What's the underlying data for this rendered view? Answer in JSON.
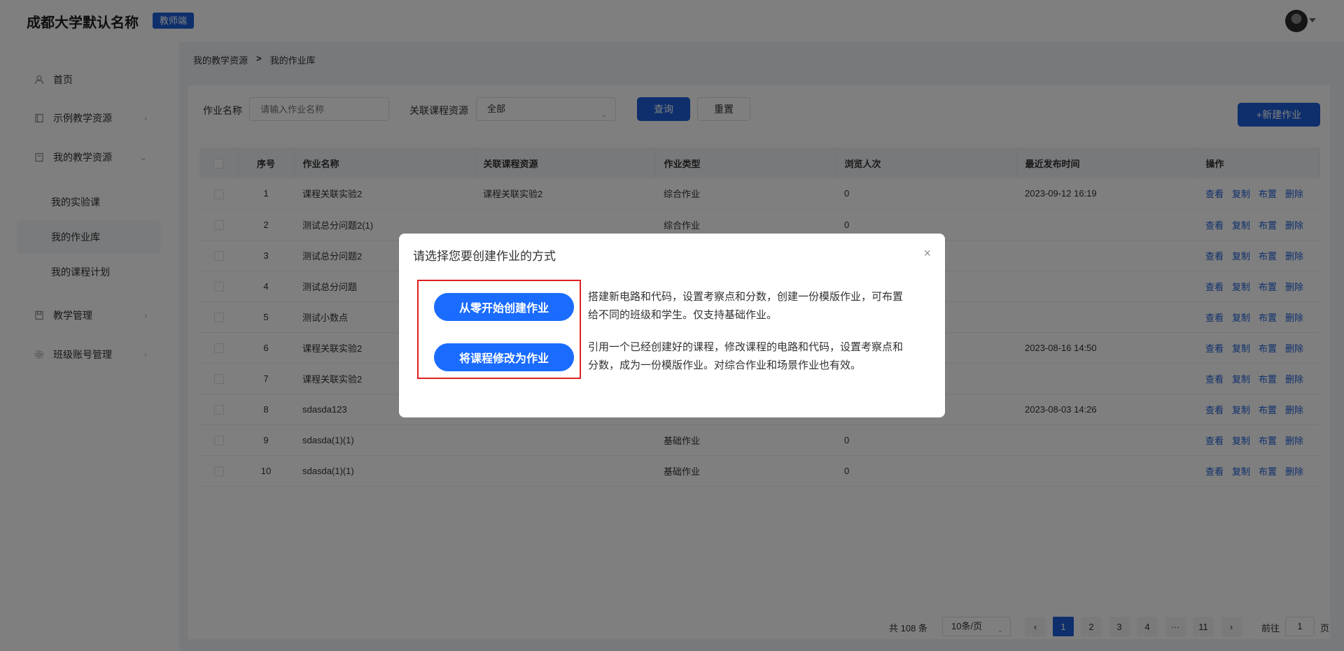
{
  "header": {
    "brand": "成都大学默认名称",
    "badge": "教师端"
  },
  "sidebar": {
    "items": [
      {
        "label": "首页",
        "icon": "user-icon"
      },
      {
        "label": "示例教学资源",
        "icon": "book-icon"
      },
      {
        "label": "我的教学资源",
        "icon": "bookmark-icon"
      },
      {
        "label": "教学管理",
        "icon": "save-icon"
      },
      {
        "label": "班级账号管理",
        "icon": "gear-icon"
      }
    ],
    "subitems": [
      {
        "label": "我的实验课"
      },
      {
        "label": "我的作业库"
      },
      {
        "label": "我的课程计划"
      }
    ]
  },
  "breadcrumb": {
    "parent": "我的教学资源",
    "separator": ">",
    "current": "我的作业库"
  },
  "filter": {
    "name_label": "作业名称",
    "name_placeholder": "请输入作业名称",
    "course_label": "关联课程资源",
    "course_value": "全部",
    "search": "查询",
    "reset": "重置",
    "new": "+新建作业"
  },
  "table": {
    "headers": [
      "序号",
      "作业名称",
      "关联课程资源",
      "作业类型",
      "浏览人次",
      "最近发布时间",
      "操作"
    ],
    "actions": [
      "查看",
      "复制",
      "布置",
      "删除"
    ],
    "rows": [
      {
        "no": "1",
        "name": "课程关联实验2",
        "course": "课程关联实验2",
        "type": "综合作业",
        "views": "0",
        "time": "2023-09-12 16:19"
      },
      {
        "no": "2",
        "name": "测试总分问题2(1)",
        "course": "",
        "type": "综合作业",
        "views": "0",
        "time": ""
      },
      {
        "no": "3",
        "name": "测试总分问题2",
        "course": "",
        "type": "",
        "views": "",
        "time": ""
      },
      {
        "no": "4",
        "name": "测试总分问题",
        "course": "",
        "type": "",
        "views": "",
        "time": ""
      },
      {
        "no": "5",
        "name": "测试小数点",
        "course": "",
        "type": "",
        "views": "",
        "time": ""
      },
      {
        "no": "6",
        "name": "课程关联实验2",
        "course": "",
        "type": "",
        "views": "",
        "time": "2023-08-16 14:50"
      },
      {
        "no": "7",
        "name": "课程关联实验2",
        "course": "",
        "type": "",
        "views": "",
        "time": ""
      },
      {
        "no": "8",
        "name": "sdasda123",
        "course": "",
        "type": "",
        "views": "",
        "time": "2023-08-03 14:26"
      },
      {
        "no": "9",
        "name": "sdasda(1)(1)",
        "course": "",
        "type": "基础作业",
        "views": "0",
        "time": ""
      },
      {
        "no": "10",
        "name": "sdasda(1)(1)",
        "course": "",
        "type": "基础作业",
        "views": "0",
        "time": ""
      }
    ]
  },
  "pagination": {
    "total": "共 108 条",
    "page_size": "10条/页",
    "prev": "‹",
    "next": "›",
    "pages": [
      "1",
      "2",
      "3",
      "4",
      "···",
      "11"
    ],
    "current": "1",
    "goto_prefix": "前往",
    "goto_value": "1",
    "goto_suffix": "页"
  },
  "dialog": {
    "title": "请选择您要创建作业的方式",
    "close": "×",
    "option1_label": "从零开始创建作业",
    "option1_desc": "搭建新电路和代码，设置考察点和分数，创建一份模版作业，可布置给不同的班级和学生。仅支持基础作业。",
    "option2_label": "将课程修改为作业",
    "option2_desc": "引用一个已经创建好的课程，修改课程的电路和代码，设置考察点和分数，成为一份模版作业。对综合作业和场景作业也有效。"
  },
  "colors": {
    "primary": "#1d5fd8",
    "pill": "#1a6cff",
    "highlight": "#e02020"
  }
}
